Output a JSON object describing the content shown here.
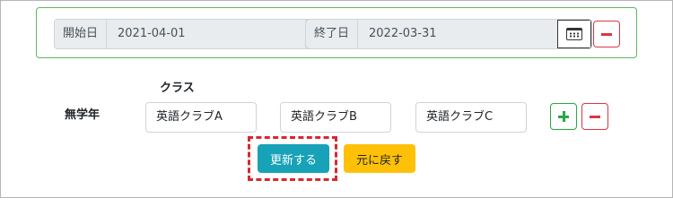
{
  "period": {
    "start_label": "開始日",
    "start_value": "2021-04-01",
    "end_label": "終了日",
    "end_value": "2022-03-31"
  },
  "class_section": {
    "heading": "クラス",
    "grade_label": "無学年",
    "clubs": [
      "英語クラブA",
      "英語クラブB",
      "英語クラブC"
    ]
  },
  "actions": {
    "update_label": "更新する",
    "back_label": "元に戻す"
  },
  "colors": {
    "success": "#28a745",
    "danger": "#dc3545",
    "info": "#17a2b8",
    "warning": "#ffc107",
    "highlight": "#d9272e"
  },
  "icons": {
    "calendar": "calendar-icon",
    "minus": "minus-icon",
    "plus": "plus-icon"
  }
}
